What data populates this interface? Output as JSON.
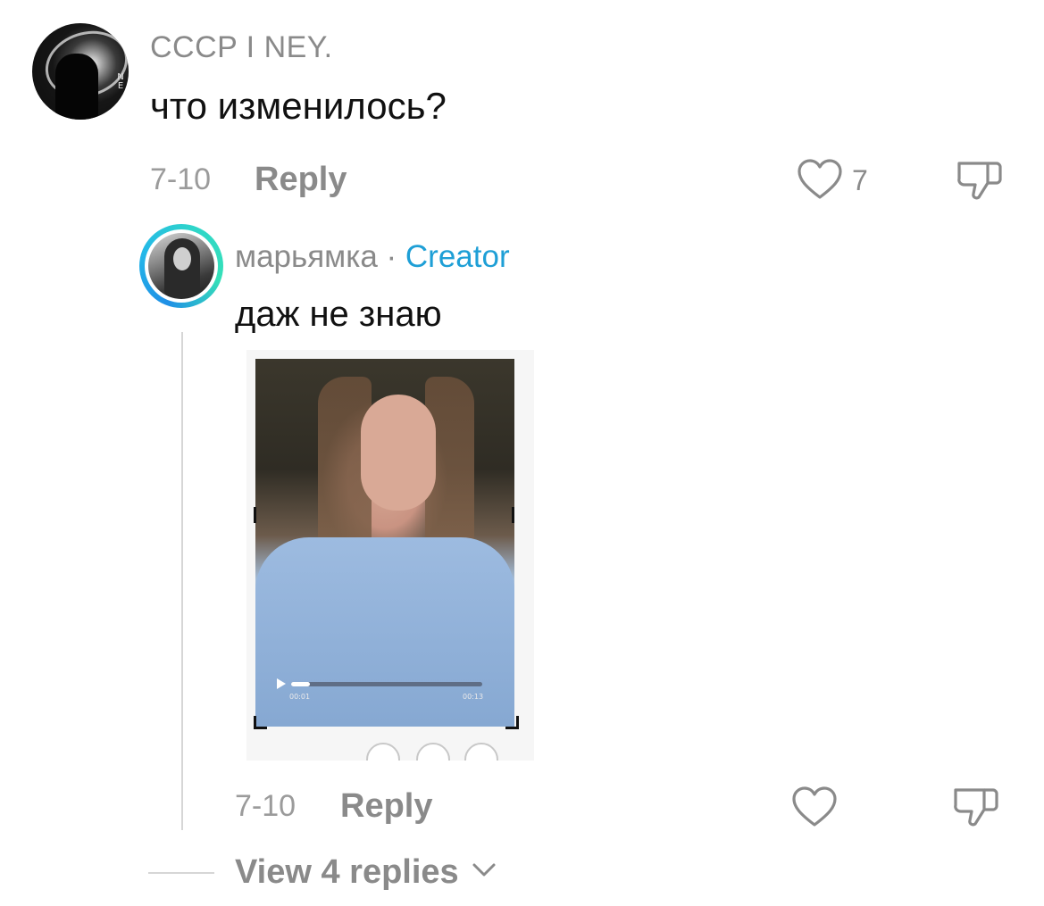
{
  "comment": {
    "username": "CCCP I NEY.",
    "avatar_mark": "N E",
    "text": "что изменилось?",
    "date": "7-10",
    "reply_label": "Reply",
    "like_count": "7"
  },
  "reply": {
    "username": "марьямка",
    "separator": " · ",
    "badge": "Creator",
    "text": "даж не знаю",
    "video": {
      "time_current": "00:01",
      "time_total": "00:13",
      "progress": 0.1
    },
    "date": "7-10",
    "reply_label": "Reply"
  },
  "view_replies_label": "View 4 replies",
  "colors": {
    "creator_badge": "#1e9fd6",
    "meta_text": "#8a8a8a",
    "avatar_ring_start": "#1f8fe6",
    "avatar_ring_end": "#35e0b8"
  },
  "icons": [
    "heart-icon",
    "dislike-icon",
    "play-icon",
    "chevron-down-icon"
  ]
}
